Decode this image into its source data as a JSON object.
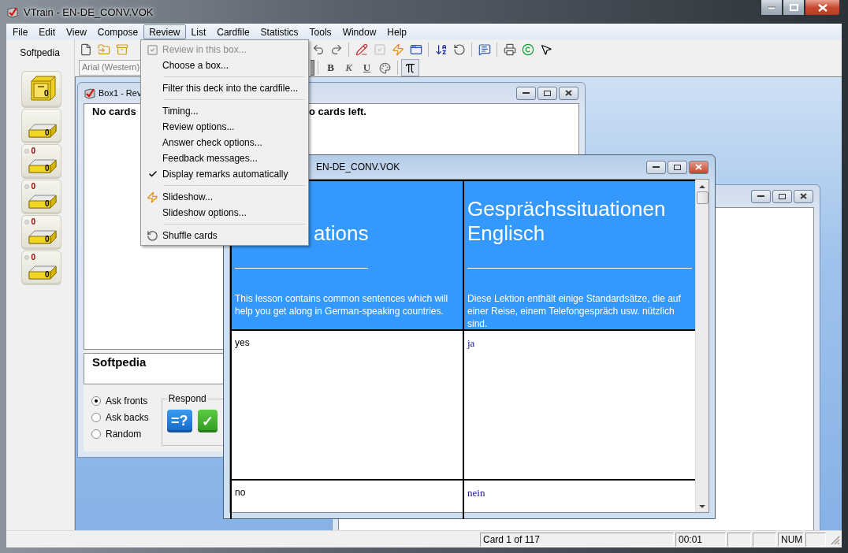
{
  "window": {
    "title": "VTrain - EN-DE_CONV.VOK"
  },
  "menu_bar": [
    {
      "label": "File",
      "selected": false
    },
    {
      "label": "Edit",
      "selected": false
    },
    {
      "label": "View",
      "selected": false
    },
    {
      "label": "Compose",
      "selected": false
    },
    {
      "label": "Review",
      "selected": true
    },
    {
      "label": "List",
      "selected": false
    },
    {
      "label": "Cardfile",
      "selected": false
    },
    {
      "label": "Statistics",
      "selected": false
    },
    {
      "label": "Tools",
      "selected": false
    },
    {
      "label": "Window",
      "selected": false
    },
    {
      "label": "Help",
      "selected": false
    }
  ],
  "review_menu": [
    {
      "kind": "review",
      "label": "Review in this box...",
      "disabled": true,
      "checked": false
    },
    {
      "kind": "item",
      "label": "Choose a box...",
      "disabled": false,
      "checked": false
    },
    {
      "kind": "separator"
    },
    {
      "kind": "item",
      "label": "Filter this deck into the cardfile...",
      "disabled": false,
      "checked": false
    },
    {
      "kind": "separator"
    },
    {
      "kind": "item",
      "label": "Timing...",
      "disabled": false,
      "checked": false
    },
    {
      "kind": "item",
      "label": "Review options...",
      "disabled": false,
      "checked": false
    },
    {
      "kind": "item",
      "label": "Answer check options...",
      "disabled": false,
      "checked": false
    },
    {
      "kind": "item",
      "label": "Feedback messages...",
      "disabled": false,
      "checked": false
    },
    {
      "kind": "item",
      "label": "Display remarks automatically",
      "disabled": false,
      "checked": true
    },
    {
      "kind": "separator"
    },
    {
      "kind": "slideshow",
      "label": "Slideshow...",
      "disabled": false,
      "checked": false
    },
    {
      "kind": "item",
      "label": "Slideshow options...",
      "disabled": false,
      "checked": false
    },
    {
      "kind": "separator"
    },
    {
      "kind": "shuffle",
      "label": "Shuffle cards",
      "disabled": false,
      "checked": false
    }
  ],
  "toolbar": [
    [
      {
        "kind": "new",
        "disabled": false
      },
      {
        "kind": "open",
        "disabled": false
      },
      {
        "kind": "box",
        "disabled": false
      }
    ],
    [
      {
        "kind": "undo",
        "disabled": false
      },
      {
        "kind": "redo",
        "disabled": false
      }
    ],
    [
      {
        "kind": "edit",
        "disabled": false
      },
      {
        "kind": "check",
        "disabled": true
      },
      {
        "kind": "slideshow",
        "disabled": false
      },
      {
        "kind": "window",
        "disabled": false
      }
    ],
    [
      {
        "kind": "sort",
        "disabled": false
      },
      {
        "kind": "shuffle",
        "disabled": false
      }
    ],
    [
      {
        "kind": "find",
        "disabled": false
      }
    ],
    [
      {
        "kind": "print",
        "disabled": false
      },
      {
        "kind": "copyright",
        "disabled": false
      },
      {
        "kind": "help",
        "disabled": false
      }
    ]
  ],
  "format_toolbar": {
    "font": "Arial (Western)",
    "groups": [
      [
        {
          "kind": "bold",
          "label": "B",
          "pressed": false
        },
        {
          "kind": "italic",
          "label": "K",
          "pressed": false
        },
        {
          "kind": "underline",
          "label": "U",
          "pressed": false
        },
        {
          "kind": "font",
          "pressed": false
        }
      ],
      [
        {
          "kind": "formula",
          "pressed": true
        }
      ]
    ]
  },
  "cardfile": {
    "name": "Softpedia",
    "boxes": [
      {
        "kind": "cabinet",
        "count": "0"
      },
      {
        "kind": "tray",
        "count": "0"
      },
      {
        "kind": "tray",
        "due": "0",
        "count": "0"
      },
      {
        "kind": "tray",
        "due": "0",
        "count": "0"
      },
      {
        "kind": "tray",
        "due": "0",
        "count": "0"
      },
      {
        "kind": "tray",
        "due": "0",
        "count": "0"
      }
    ]
  },
  "box_window": {
    "title": "Box1 - Rev",
    "message_left": "No cards",
    "message_right": "o cards left.",
    "remark": "Softpedia",
    "ask_options": [
      {
        "label": "Ask fronts",
        "selected": true
      },
      {
        "label": "Ask backs",
        "selected": false
      },
      {
        "label": "Random",
        "selected": false
      }
    ],
    "respond": {
      "label": "Respond",
      "buttons": [
        {
          "kind": "show-answer",
          "label": "=?"
        },
        {
          "kind": "correct",
          "label": "✓"
        }
      ]
    }
  },
  "deck_window": {
    "title": "EN-DE_CONV.VOK",
    "header": [
      {
        "title": "ations",
        "description": "This lesson contains common sentences which will help you get along in German-speaking countries."
      },
      {
        "title": "Gesprächssituationen Englisch",
        "description": "Diese Lektion enthält einige Standardsätze, die auf einer Reise, einem Telefongespräch usw. nützlich sind."
      }
    ],
    "rows": [
      [
        "yes",
        "ja"
      ],
      [
        "no",
        "nein"
      ]
    ]
  },
  "status_bar": {
    "card": "Card 1 of 117",
    "time": "00:01",
    "num": "NUM"
  }
}
